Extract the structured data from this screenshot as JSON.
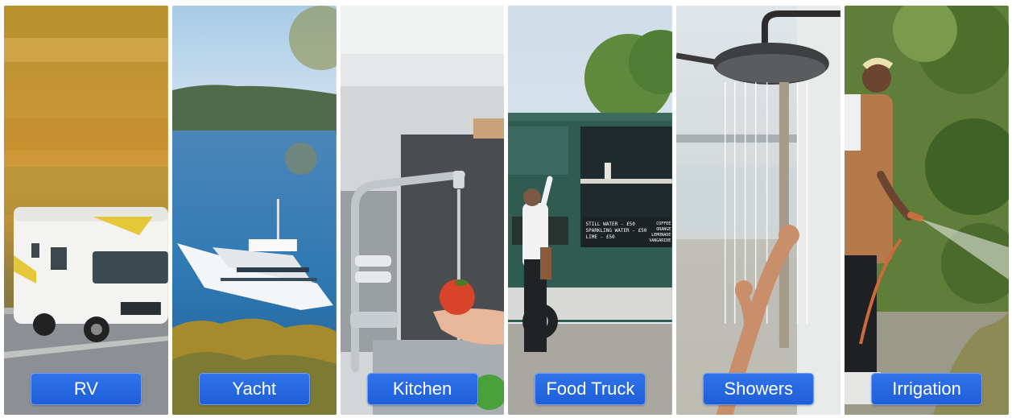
{
  "panels": [
    {
      "id": "rv",
      "label": "RV"
    },
    {
      "id": "yacht",
      "label": "Yacht"
    },
    {
      "id": "kitchen",
      "label": "Kitchen"
    },
    {
      "id": "food-truck",
      "label": "Food Truck"
    },
    {
      "id": "showers",
      "label": "Showers"
    },
    {
      "id": "irrigation",
      "label": "Irrigation"
    }
  ],
  "food_truck_menu": {
    "lines": [
      "STILL WATER - £50",
      "SPARKLING WATER - £50",
      "LIME - £50"
    ],
    "side_lines": [
      "COFFEE",
      "ORANGE",
      "LEMONADE",
      "VANGARIDE"
    ]
  },
  "colors": {
    "label_bg": "#2563e0",
    "label_text": "#ffffff"
  }
}
